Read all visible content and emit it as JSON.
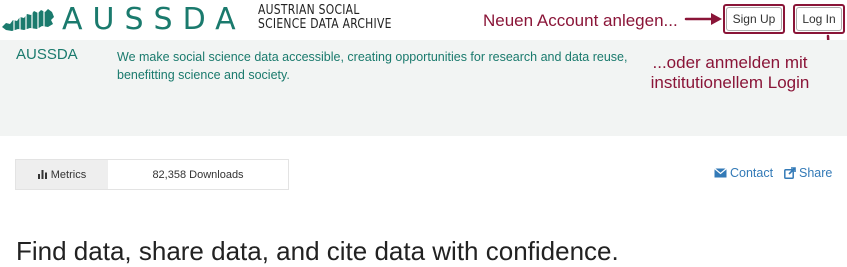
{
  "header": {
    "logo_word": "AUSSDA",
    "logo_subtitle_line1": "AUSTRIAN SOCIAL",
    "logo_subtitle_line2": "SCIENCE DATA ARCHIVE",
    "signup_label": "Sign Up",
    "login_label": "Log In",
    "brand_color": "#1a7a6d"
  },
  "annotations": {
    "signup_note": "Neuen Account anlegen...",
    "login_note_line1": "...oder anmelden mit",
    "login_note_line2": "institutionellem Login",
    "color": "#8a1538"
  },
  "band": {
    "title": "AUSSDA",
    "description": "We make social science data accessible, creating opportunities for research and data reuse, benefitting science and society."
  },
  "metrics": {
    "tab_label": "Metrics",
    "downloads": "82,358 Downloads",
    "icon": "bar-chart-icon"
  },
  "links": {
    "contact": "Contact",
    "share": "Share",
    "contact_icon": "envelope-icon",
    "share_icon": "share-icon"
  },
  "main": {
    "headline": "Find data, share data, and cite data with confidence."
  }
}
